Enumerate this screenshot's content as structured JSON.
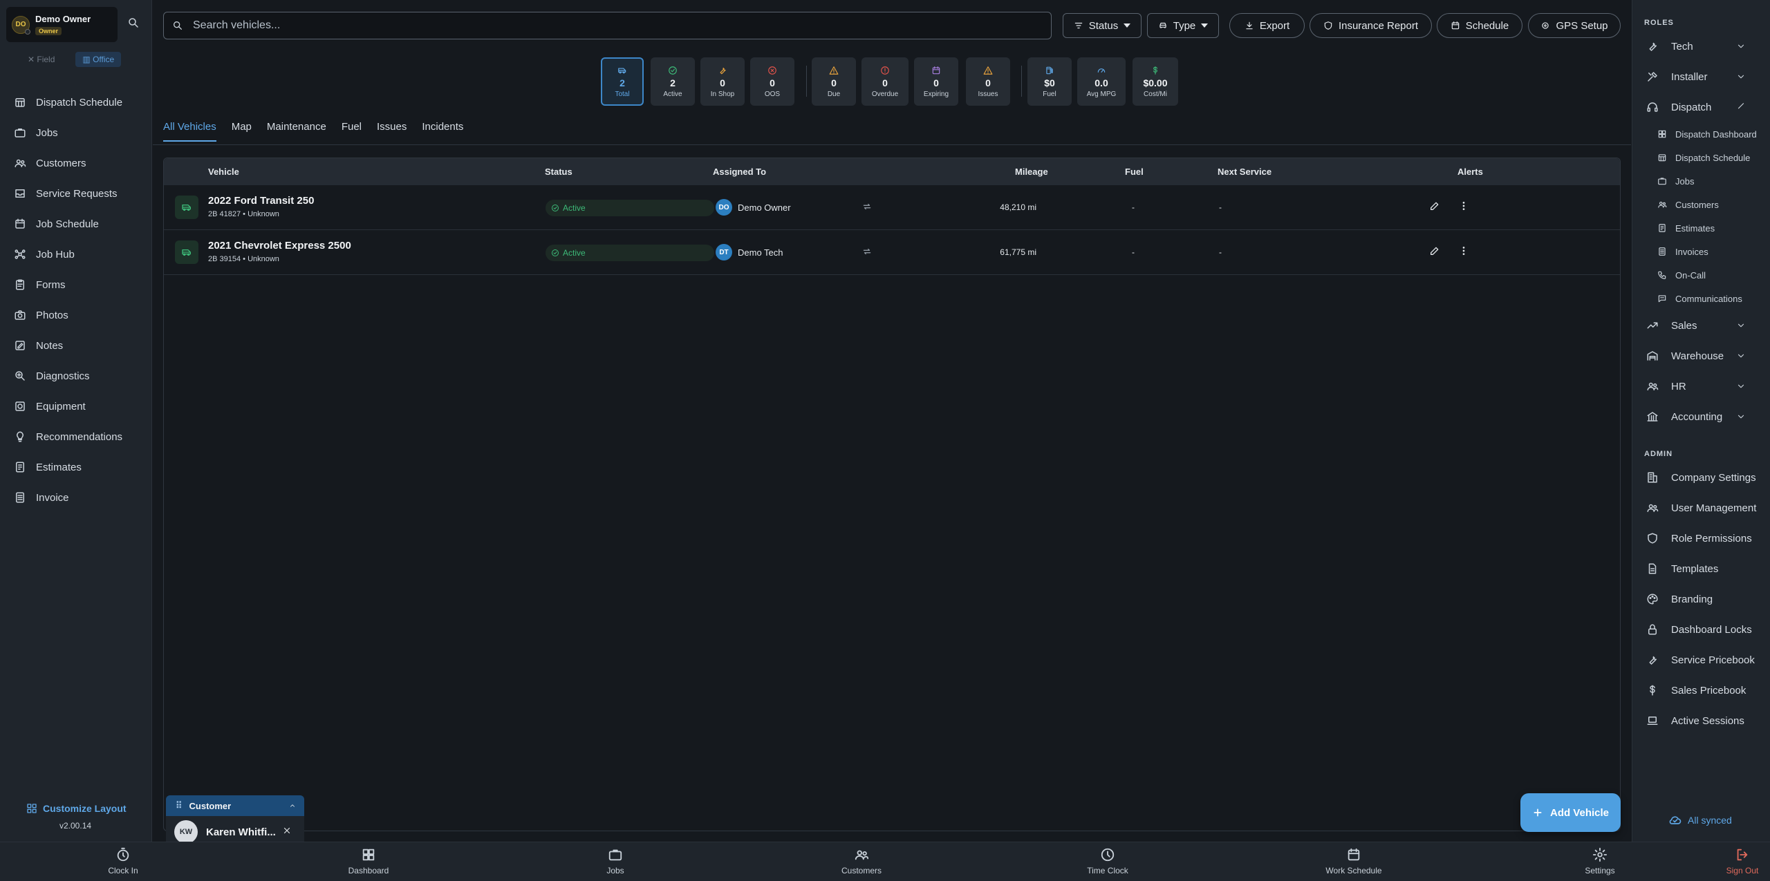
{
  "user": {
    "initials": "DO",
    "name": "Demo Owner",
    "role": "Owner"
  },
  "mode": {
    "field": "Field",
    "office": "Office"
  },
  "left_nav": [
    {
      "label": "Dispatch Schedule",
      "icon": "calendar-grid-icon"
    },
    {
      "label": "Jobs",
      "icon": "briefcase-icon"
    },
    {
      "label": "Customers",
      "icon": "people-icon"
    },
    {
      "label": "Service Requests",
      "icon": "inbox-icon"
    },
    {
      "label": "Job Schedule",
      "icon": "calendar-icon"
    },
    {
      "label": "Job Hub",
      "icon": "hub-icon"
    },
    {
      "label": "Forms",
      "icon": "clipboard-icon"
    },
    {
      "label": "Photos",
      "icon": "camera-icon"
    },
    {
      "label": "Notes",
      "icon": "note-icon"
    },
    {
      "label": "Diagnostics",
      "icon": "search-gear-icon"
    },
    {
      "label": "Equipment",
      "icon": "equipment-icon"
    },
    {
      "label": "Recommendations",
      "icon": "lightbulb-icon"
    },
    {
      "label": "Estimates",
      "icon": "estimate-icon"
    },
    {
      "label": "Invoice",
      "icon": "invoice-icon"
    }
  ],
  "customize_label": "Customize Layout",
  "version": "v2.00.14",
  "search": {
    "placeholder": "Search vehicles..."
  },
  "toolbar": {
    "status": "Status",
    "type": "Type",
    "export": "Export",
    "insurance": "Insurance Report",
    "schedule": "Schedule",
    "gps": "GPS Setup"
  },
  "stats": [
    {
      "value": "2",
      "label": "Total",
      "icon": "van-icon",
      "color": "#5fa8e8"
    },
    {
      "value": "2",
      "label": "Active",
      "icon": "check-circle-icon",
      "color": "#3dba78"
    },
    {
      "value": "0",
      "label": "In Shop",
      "icon": "wrench-icon",
      "color": "#e8a23d"
    },
    {
      "value": "0",
      "label": "OOS",
      "icon": "x-circle-icon",
      "color": "#e0524a"
    },
    {
      "value": "0",
      "label": "Due",
      "icon": "warning-icon",
      "color": "#e8a23d"
    },
    {
      "value": "0",
      "label": "Overdue",
      "icon": "alert-circle-icon",
      "color": "#e0524a"
    },
    {
      "value": "0",
      "label": "Expiring",
      "icon": "calendar-icon",
      "color": "#a87fe0"
    },
    {
      "value": "0",
      "label": "Issues",
      "icon": "warning-icon",
      "color": "#e8a23d"
    },
    {
      "value": "$0",
      "label": "Fuel",
      "icon": "fuel-icon",
      "color": "#5fa8e8"
    },
    {
      "value": "0.0",
      "label": "Avg MPG",
      "icon": "gauge-icon",
      "color": "#5fa8e8"
    },
    {
      "value": "$0.00",
      "label": "Cost/Mi",
      "icon": "dollar-icon",
      "color": "#3dba78"
    }
  ],
  "tabs": [
    "All Vehicles",
    "Map",
    "Maintenance",
    "Fuel",
    "Issues",
    "Incidents"
  ],
  "table": {
    "headers": {
      "vehicle": "Vehicle",
      "status": "Status",
      "assigned": "Assigned To",
      "mileage": "Mileage",
      "fuel": "Fuel",
      "next_service": "Next Service",
      "alerts": "Alerts"
    },
    "rows": [
      {
        "name": "2022 Ford Transit 250",
        "sub": "2B 41827 • Unknown",
        "status": "Active",
        "initials": "DO",
        "assigned": "Demo Owner",
        "mileage": "48,210 mi",
        "fuel": "-",
        "next_service": "-"
      },
      {
        "name": "2021 Chevrolet Express 2500",
        "sub": "2B 39154 • Unknown",
        "status": "Active",
        "initials": "DT",
        "assigned": "Demo Tech",
        "mileage": "61,775 mi",
        "fuel": "-",
        "next_service": "-"
      }
    ]
  },
  "customer_widget": {
    "title": "Customer",
    "initials": "KW",
    "name": "Karen Whitfi..."
  },
  "add_vehicle": "Add Vehicle",
  "right": {
    "roles_heading": "ROLES",
    "roles": [
      {
        "label": "Tech",
        "icon": "wrench-icon",
        "expanded": false
      },
      {
        "label": "Installer",
        "icon": "tools-icon",
        "expanded": false
      },
      {
        "label": "Dispatch",
        "icon": "headset-icon",
        "expanded": true
      }
    ],
    "dispatch_items": [
      {
        "label": "Dispatch Dashboard",
        "icon": "dashboard-icon"
      },
      {
        "label": "Dispatch Schedule",
        "icon": "calendar-grid-icon"
      },
      {
        "label": "Jobs",
        "icon": "briefcase-icon"
      },
      {
        "label": "Customers",
        "icon": "people-icon"
      },
      {
        "label": "Estimates",
        "icon": "estimate-icon"
      },
      {
        "label": "Invoices",
        "icon": "invoice-icon"
      },
      {
        "label": "On-Call",
        "icon": "phone-icon"
      },
      {
        "label": "Communications",
        "icon": "chat-icon"
      }
    ],
    "more_roles": [
      {
        "label": "Sales",
        "icon": "trend-icon"
      },
      {
        "label": "Warehouse",
        "icon": "warehouse-icon"
      },
      {
        "label": "HR",
        "icon": "people-icon"
      },
      {
        "label": "Accounting",
        "icon": "bank-icon"
      }
    ],
    "admin_heading": "ADMIN",
    "admin": [
      {
        "label": "Company Settings",
        "icon": "building-icon"
      },
      {
        "label": "User Management",
        "icon": "people-icon"
      },
      {
        "label": "Role Permissions",
        "icon": "shield-icon"
      },
      {
        "label": "Templates",
        "icon": "document-icon"
      },
      {
        "label": "Branding",
        "icon": "palette-icon"
      },
      {
        "label": "Dashboard Locks",
        "icon": "lock-icon"
      },
      {
        "label": "Service Pricebook",
        "icon": "wrench-icon"
      },
      {
        "label": "Sales Pricebook",
        "icon": "dollar-icon"
      },
      {
        "label": "Active Sessions",
        "icon": "laptop-icon"
      }
    ],
    "synced": "All synced"
  },
  "bottom_nav": [
    {
      "label": "Clock In",
      "icon": "stopwatch-icon"
    },
    {
      "label": "Dashboard",
      "icon": "dashboard-icon"
    },
    {
      "label": "Jobs",
      "icon": "briefcase-icon"
    },
    {
      "label": "Customers",
      "icon": "people-icon"
    },
    {
      "label": "Time Clock",
      "icon": "clock-icon"
    },
    {
      "label": "Work Schedule",
      "icon": "calendar-icon"
    },
    {
      "label": "Settings",
      "icon": "gear-icon"
    },
    {
      "label": "Sign Out",
      "icon": "sign-out-icon"
    }
  ]
}
